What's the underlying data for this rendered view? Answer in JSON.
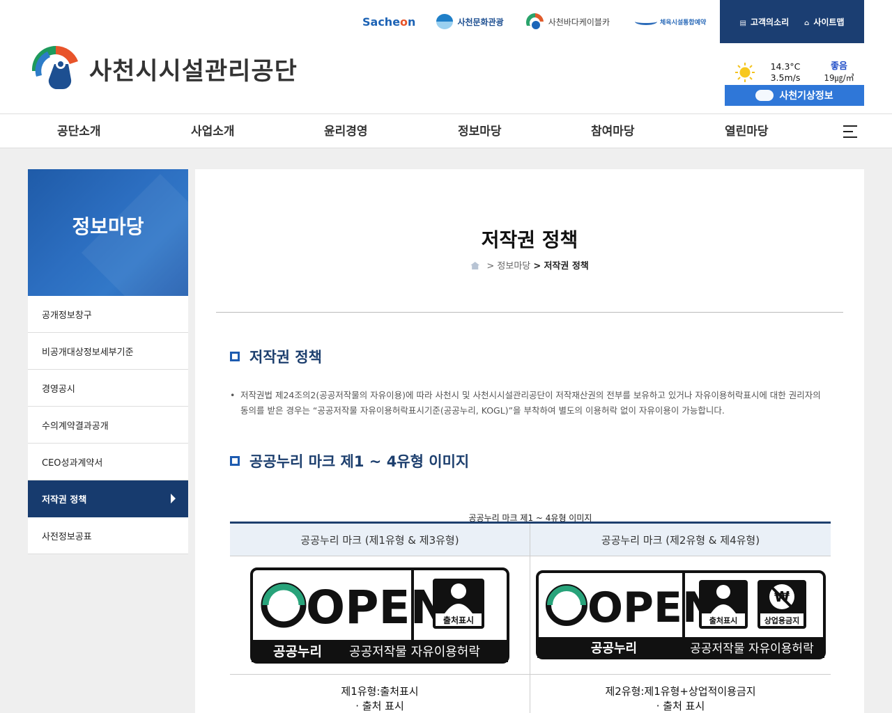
{
  "top_links": {
    "sacheon": "Sacheon",
    "sacheon_prefix": "Sache",
    "sacheon_o": "o",
    "sacheon_suffix": "n",
    "culture": "사천문화관광",
    "cable": "사천바다케이블카",
    "sports": "체육시설통합예약"
  },
  "util": {
    "voice": "고객의소리",
    "sitemap": "사이트맵"
  },
  "logo": {
    "text": "사천시시설관리공단"
  },
  "weather": {
    "temperature": "14.3°C",
    "wind": "3.5m/s",
    "air_status": "좋음",
    "pm": "19㎍/㎥",
    "button": "사천기상정보"
  },
  "gnb": [
    "공단소개",
    "사업소개",
    "윤리경영",
    "정보마당",
    "참여마당",
    "열린마당"
  ],
  "snb": {
    "title": "정보마당",
    "items": [
      "공개정보창구",
      "비공개대상정보세부기준",
      "경영공시",
      "수의계약결과공개",
      "CEO성과계약서",
      "저작권 정책",
      "사전정보공표"
    ]
  },
  "page": {
    "title": "저작권 정책",
    "crumb_sep": ">",
    "crumb_parent": "정보마당",
    "crumb_current": "저작권 정책",
    "section1": "저작권 정책",
    "bullet": "저작권법 제24조의2(공공저작물의 자유이용)에 따라 사천시 및 사천시시설관리공단이 저작재산권의 전부를 보유하고 있거나 자유이용허락표시에 대한 권리자의 동의를 받은 경우는 “공공저작물 자유이용허락표시기준(공공누리, KOGL)”을 부착하여 별도의 이용허락 없이 자유이용이 가능합니다.",
    "section2": "공공누리 마크 제1 ~ 4유형 이미지",
    "table_caption": "공공누리 마크 제1 ~ 4유형 이미지",
    "col1": "공공누리 마크 (제1유형 & 제3유형)",
    "col2": "공공누리 마크 (제2유형 & 제4유형)",
    "kogl_open": "OPEN",
    "kogl_name": "공공누리",
    "kogl_sub": "공공저작물 자유이용허락",
    "badge_source": "출처표시",
    "badge_nocommercial": "상업용금지",
    "type1_desc": "제1유형:출처표시",
    "type1_detail": "· 출처 표시",
    "type2_desc": "제2유형:제1유형+상업적이용금지",
    "type2_detail": "· 출처 표시"
  }
}
